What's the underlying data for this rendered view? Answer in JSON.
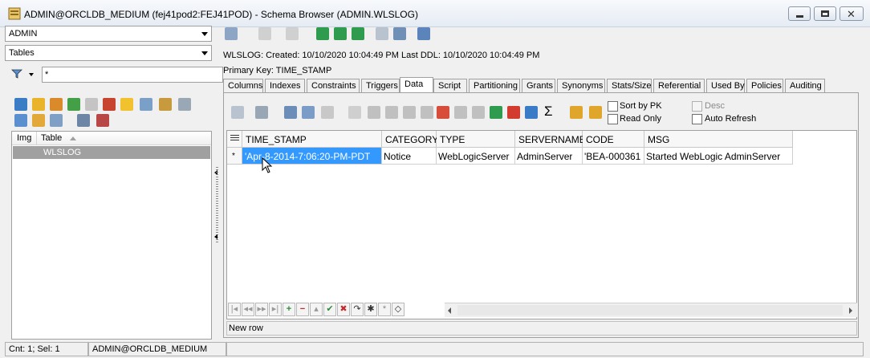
{
  "window": {
    "title": "ADMIN@ORCLDB_MEDIUM (fej41pod2:FEJ41POD) - Schema Browser (ADMIN.WLSLOG)"
  },
  "left": {
    "schema": "ADMIN",
    "object_type": "Tables",
    "filter_value": "*",
    "tree": {
      "columns": [
        "Img",
        "Table"
      ],
      "rows": [
        "WLSLOG"
      ]
    }
  },
  "info": {
    "line1": "WLSLOG:  Created:  10/10/2020  10:04:49 PM   Last DDL:  10/10/2020  10:04:49 PM",
    "line2": "Primary Key:  TIME_STAMP"
  },
  "tabs": [
    "Columns",
    "Indexes",
    "Constraints",
    "Triggers",
    "Data",
    "Script",
    "Partitioning",
    "Grants",
    "Synonyms",
    "Stats/Size",
    "Referential",
    "Used By",
    "Policies",
    "Auditing"
  ],
  "active_tab": "Data",
  "data_toolbar": {
    "sort_by_pk": "Sort by PK",
    "read_only": "Read Only",
    "desc": "Desc",
    "auto_refresh": "Auto Refresh",
    "sigma": "Σ"
  },
  "grid": {
    "columns": [
      "TIME_STAMP",
      "CATEGORY",
      "TYPE",
      "SERVERNAME",
      "CODE",
      "MSG"
    ],
    "rows": [
      [
        "'Apr-8-2014-7:06:20-PM-PDT",
        "Notice",
        "WebLogicServer",
        "AdminServer",
        "'BEA-000361",
        "Started WebLogic AdminServer"
      ]
    ],
    "row_marker": "*"
  },
  "nav_buttons": [
    "|◂",
    "◂◂",
    "▸▸",
    "▸|",
    "+",
    "−",
    "▴",
    "✔",
    "✖",
    "↷",
    "✱",
    "*",
    "◇"
  ],
  "new_row_label": "New row",
  "status": {
    "count": "Cnt: 1; Sel: 1",
    "connection": "ADMIN@ORCLDB_MEDIUM"
  },
  "colors": {
    "selection": "#3399ff",
    "tree_selected": "#a0a0a0"
  }
}
